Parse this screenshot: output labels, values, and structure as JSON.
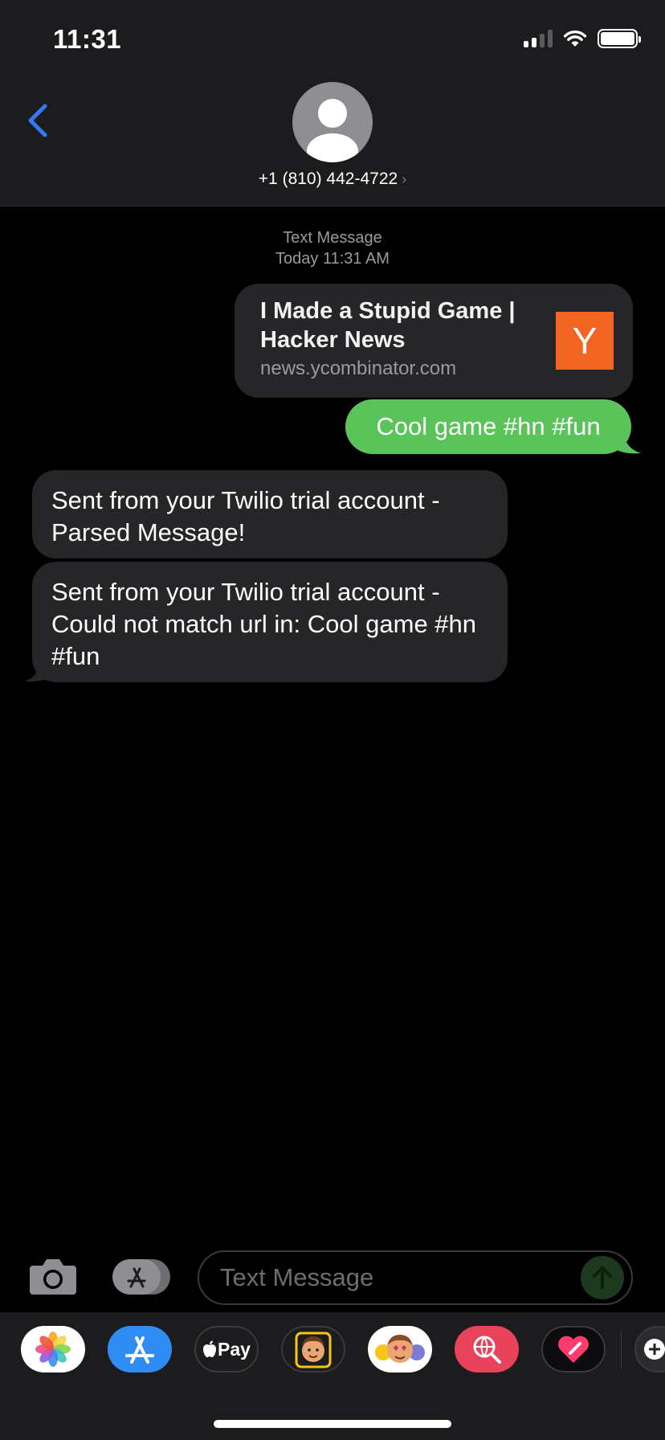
{
  "status_bar": {
    "time": "11:31"
  },
  "header": {
    "contact": "+1 (810) 442-4722",
    "chevron": "›",
    "icons": {
      "back": "chevron-left-icon",
      "avatar": "person-icon"
    }
  },
  "thread": {
    "service_label": "Text Message",
    "timestamp": "Today 11:31 AM",
    "link_preview": {
      "title": "I Made a Stupid Game | Hacker News",
      "domain": "news.ycombinator.com",
      "logo_letter": "Y",
      "logo_color": "#f26522"
    },
    "sent_message": "Cool game #hn #fun",
    "received": [
      "Sent from your Twilio trial account - Parsed Message!",
      "Sent from your Twilio trial account - Could not match url in: Cool game #hn #fun"
    ]
  },
  "input_bar": {
    "placeholder": "Text Message",
    "value": "",
    "icons": [
      "camera-icon",
      "app-store-icon",
      "send-arrow-icon"
    ]
  },
  "app_drawer": {
    "apple_pay_label": "Pay",
    "apps": [
      "photos",
      "app-store",
      "apple-pay",
      "memoji",
      "animoji-stickers",
      "web-search",
      "digital-touch",
      "game"
    ]
  },
  "colors": {
    "sent_bubble": "#5ac35a",
    "received_bubble": "#262628",
    "accent_blue": "#3478f6",
    "header_bg": "#1c1c1e"
  }
}
